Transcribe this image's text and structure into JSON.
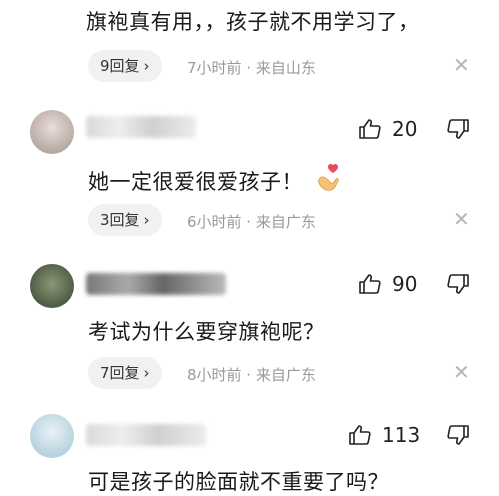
{
  "comments": [
    {
      "text": "旗袍真有用，，孩子就不用学习了，",
      "replies": "9回复",
      "meta": "7小时前 · 来自山东"
    },
    {
      "likes": "20",
      "text": "她一定很爱很爱孩子！",
      "emoji": "🫰",
      "replies": "3回复",
      "meta": "6小时前 · 来自广东"
    },
    {
      "likes": "90",
      "text": "考试为什么要穿旗袍呢？",
      "replies": "7回复",
      "meta": "8小时前 · 来自广东"
    },
    {
      "likes": "113",
      "text": "可是孩子的脸面就不重要了吗？"
    }
  ],
  "icons": {
    "like": "thumb-up-icon",
    "dislike": "thumb-down-icon",
    "close": "close-icon",
    "chevron": "chevron-right-icon"
  },
  "colors": {
    "pill_bg": "#f1f1f1",
    "meta": "#9a9a9a",
    "text": "#1a1a1a"
  }
}
